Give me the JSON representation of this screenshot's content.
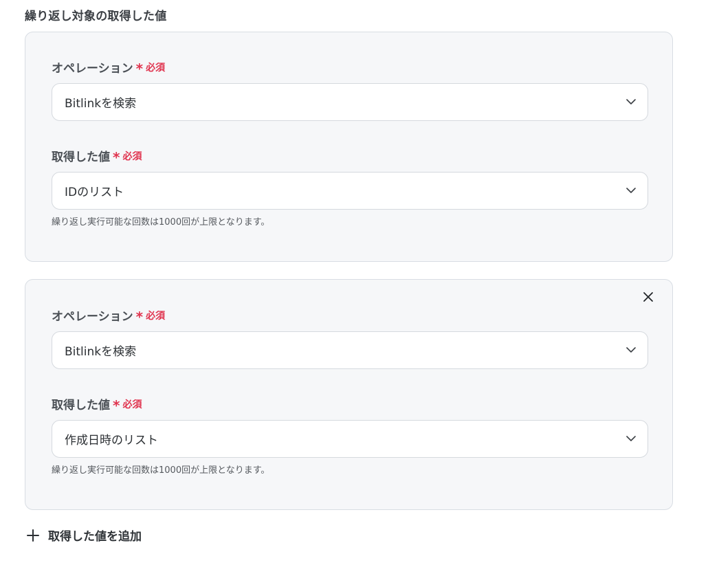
{
  "section": {
    "title": "繰り返し対象の取得した値"
  },
  "required": {
    "star": "*",
    "text": "必須"
  },
  "groups": [
    {
      "operation_label": "オペレーション",
      "operation_value": "Bitlinkを検索",
      "value_label": "取得した値",
      "value_value": "IDのリスト",
      "hint": "繰り返し実行可能な回数は1000回が上限となります。"
    },
    {
      "operation_label": "オペレーション",
      "operation_value": "Bitlinkを検索",
      "value_label": "取得した値",
      "value_value": "作成日時のリスト",
      "hint": "繰り返し実行可能な回数は1000回が上限となります。"
    }
  ],
  "add_button": {
    "label": "取得した値を追加"
  },
  "icons": {
    "chevron": "chevron-down-icon",
    "close": "close-icon",
    "plus": "plus-icon"
  },
  "colors": {
    "required": "#e0344f",
    "card_background": "#f6f7f9",
    "card_border": "#d8dde3"
  }
}
